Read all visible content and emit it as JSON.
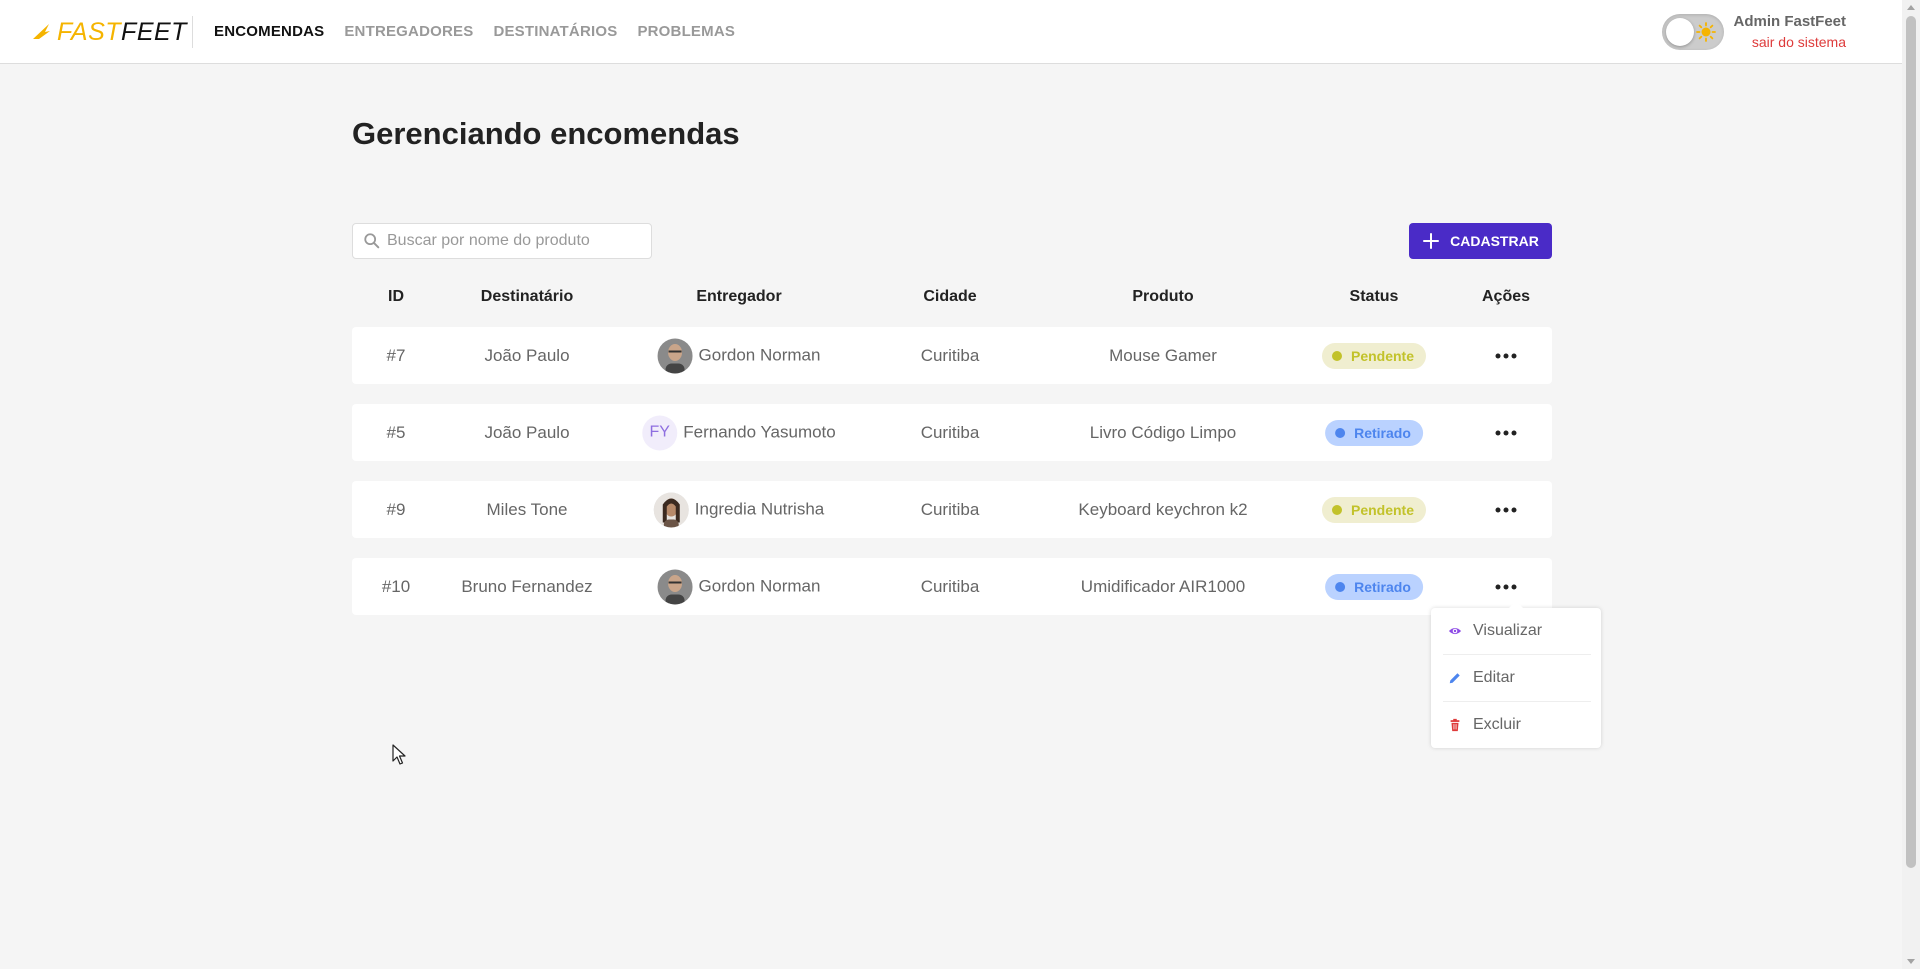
{
  "header": {
    "logo_fast": "FAST",
    "logo_feet": "FEET",
    "nav": [
      {
        "label": "ENCOMENDAS",
        "active": true
      },
      {
        "label": "ENTREGADORES",
        "active": false
      },
      {
        "label": "DESTINATÁRIOS",
        "active": false
      },
      {
        "label": "PROBLEMAS",
        "active": false
      }
    ],
    "theme_toggle": {
      "state": "light",
      "icon": "sun-icon"
    },
    "user": {
      "name": "Admin FastFeet",
      "logout": "sair do sistema"
    }
  },
  "main": {
    "title": "Gerenciando encomendas",
    "search": {
      "placeholder": "Buscar por nome do produto",
      "value": ""
    },
    "add_button": "CADASTRAR",
    "columns": [
      "ID",
      "Destinatário",
      "Entregador",
      "Cidade",
      "Produto",
      "Status",
      "Ações"
    ],
    "rows": [
      {
        "id": "#7",
        "recipient": "João Paulo",
        "deliveryman": "Gordon Norman",
        "avatar": "photo",
        "city": "Curitiba",
        "product": "Mouse Gamer",
        "status": "Pendente"
      },
      {
        "id": "#5",
        "recipient": "João Paulo",
        "deliveryman": "Fernando Yasumoto",
        "avatar": "FY",
        "city": "Curitiba",
        "product": "Livro Código Limpo",
        "status": "Retirado"
      },
      {
        "id": "#9",
        "recipient": "Miles Tone",
        "deliveryman": "Ingredia Nutrisha",
        "avatar": "photo",
        "city": "Curitiba",
        "product": "Keyboard keychron k2",
        "status": "Pendente"
      },
      {
        "id": "#10",
        "recipient": "Bruno Fernandez",
        "deliveryman": "Gordon Norman",
        "avatar": "photo",
        "city": "Curitiba",
        "product": "Umidificador AIR1000",
        "status": "Retirado"
      }
    ],
    "actions_menu": [
      {
        "label": "Visualizar",
        "icon": "eye-icon"
      },
      {
        "label": "Editar",
        "icon": "pencil-icon"
      },
      {
        "label": "Excluir",
        "icon": "trash-icon"
      }
    ]
  },
  "colors": {
    "brand_yellow": "#f5b400",
    "primary": "#4a2bc7",
    "pendente_bg": "#f0eed0",
    "pendente_fg": "#c2c22a",
    "retirado_bg": "#bad2ff",
    "retirado_fg": "#4d85ee",
    "logout": "#de3b3b"
  }
}
